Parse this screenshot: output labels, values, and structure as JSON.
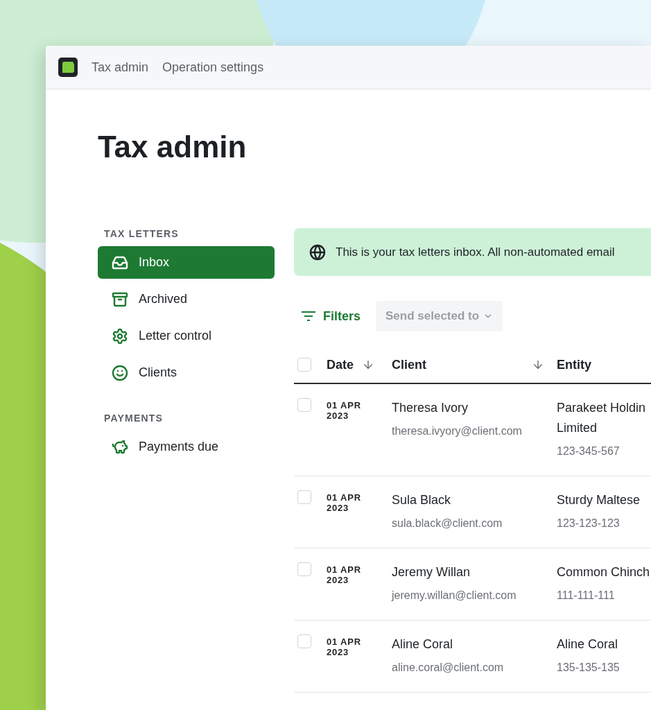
{
  "topbar": {
    "crumbs": [
      "Tax admin",
      "Operation settings"
    ]
  },
  "page_title": "Tax admin",
  "sidebar": {
    "sections": [
      {
        "heading": "TAX LETTERS",
        "items": [
          {
            "label": "Inbox",
            "selected": true
          },
          {
            "label": "Archived",
            "selected": false
          },
          {
            "label": "Letter control",
            "selected": false
          },
          {
            "label": "Clients",
            "selected": false
          }
        ]
      },
      {
        "heading": "PAYMENTS",
        "items": [
          {
            "label": "Payments due",
            "selected": false
          }
        ]
      }
    ]
  },
  "banner": "This is your tax letters inbox. All non-automated email",
  "toolbar": {
    "filters": "Filters",
    "send": {
      "label": "Send selected to",
      "disabled": true
    }
  },
  "table": {
    "header_checked": false,
    "columns": [
      {
        "label": "Date",
        "sorted": true
      },
      {
        "label": "Client",
        "sorted": true
      },
      {
        "label": "Entity",
        "sorted": false
      }
    ],
    "rows": [
      {
        "checked": false,
        "date": "01 APR 2023",
        "client": "Theresa Ivory",
        "email": "theresa.ivyory@client.com",
        "entity": "Parakeet Holdin\nLimited",
        "number": "123-345-567"
      },
      {
        "checked": false,
        "date": "01 APR 2023",
        "client": "Sula Black",
        "email": "sula.black@client.com",
        "entity": "Sturdy Maltese",
        "number": "123-123-123"
      },
      {
        "checked": false,
        "date": "01 APR 2023",
        "client": "Jeremy Willan",
        "email": "jeremy.willan@client.com",
        "entity": "Common Chinch",
        "number": "111-111-111"
      },
      {
        "checked": false,
        "date": "01 APR 2023",
        "client": "Aline Coral",
        "email": "aline.coral@client.com",
        "entity": "Aline Coral",
        "number": "135-135-135"
      }
    ]
  }
}
